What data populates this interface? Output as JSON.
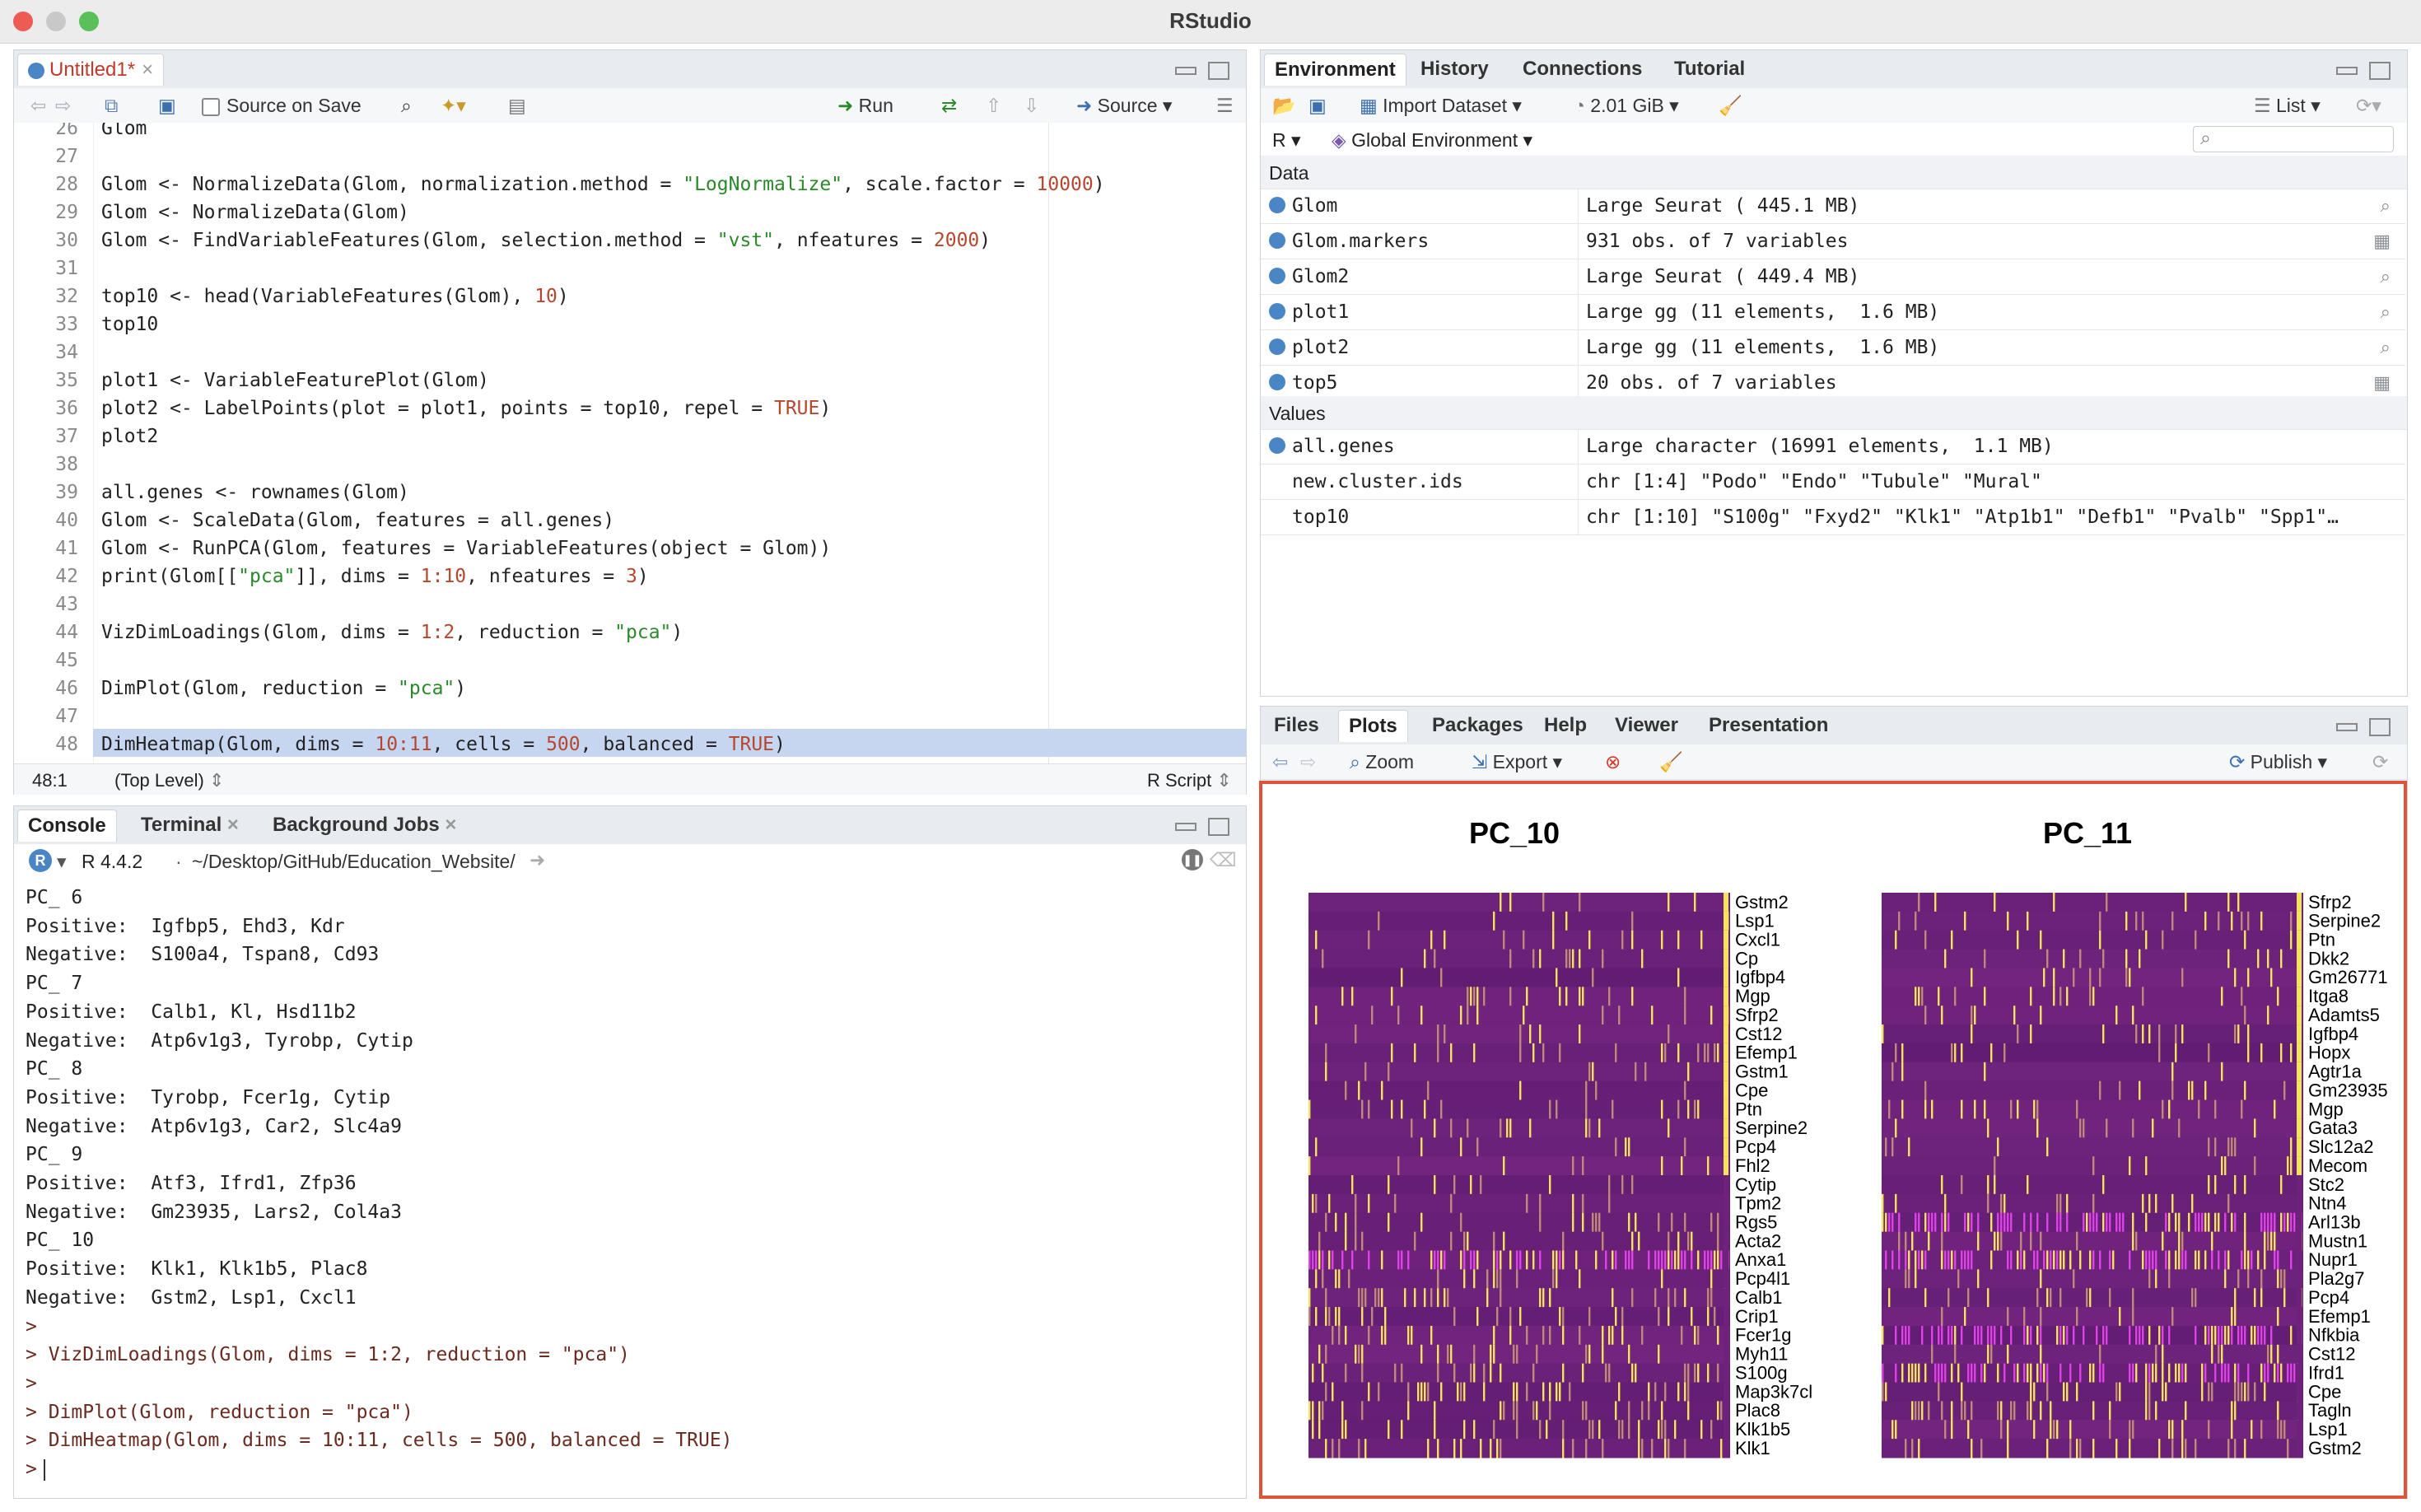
{
  "window": {
    "title": "RStudio"
  },
  "editor": {
    "tab_label": "Untitled1*",
    "source_on_save": "Source on Save",
    "run_label": "Run",
    "source_label": "Source",
    "status_pos": "48:1",
    "status_scope": "(Top Level)",
    "status_type": "R Script",
    "lines": [
      {
        "n": "26",
        "t": "Glom"
      },
      {
        "n": "27",
        "t": ""
      },
      {
        "n": "28",
        "t": "Glom <- NormalizeData(Glom, normalization.method = \"LogNormalize\", scale.factor = 10000)"
      },
      {
        "n": "29",
        "t": "Glom <- NormalizeData(Glom)"
      },
      {
        "n": "30",
        "t": "Glom <- FindVariableFeatures(Glom, selection.method = \"vst\", nfeatures = 2000)"
      },
      {
        "n": "31",
        "t": ""
      },
      {
        "n": "32",
        "t": "top10 <- head(VariableFeatures(Glom), 10)"
      },
      {
        "n": "33",
        "t": "top10"
      },
      {
        "n": "34",
        "t": ""
      },
      {
        "n": "35",
        "t": "plot1 <- VariableFeaturePlot(Glom)"
      },
      {
        "n": "36",
        "t": "plot2 <- LabelPoints(plot = plot1, points = top10, repel = TRUE)"
      },
      {
        "n": "37",
        "t": "plot2"
      },
      {
        "n": "38",
        "t": ""
      },
      {
        "n": "39",
        "t": "all.genes <- rownames(Glom)"
      },
      {
        "n": "40",
        "t": "Glom <- ScaleData(Glom, features = all.genes)"
      },
      {
        "n": "41",
        "t": "Glom <- RunPCA(Glom, features = VariableFeatures(object = Glom))"
      },
      {
        "n": "42",
        "t": "print(Glom[[\"pca\"]], dims = 1:10, nfeatures = 3)"
      },
      {
        "n": "43",
        "t": ""
      },
      {
        "n": "44",
        "t": "VizDimLoadings(Glom, dims = 1:2, reduction = \"pca\")"
      },
      {
        "n": "45",
        "t": ""
      },
      {
        "n": "46",
        "t": "DimPlot(Glom, reduction = \"pca\")"
      },
      {
        "n": "47",
        "t": ""
      },
      {
        "n": "48",
        "t": "DimHeatmap(Glom, dims = 10:11, cells = 500, balanced = TRUE)"
      }
    ]
  },
  "console": {
    "tabs": [
      "Console",
      "Terminal",
      "Background Jobs"
    ],
    "r_version": "R 4.4.2",
    "path": "~/Desktop/GitHub/Education_Website/",
    "lines": [
      "PC_ 6",
      "Positive:  Igfbp5, Ehd3, Kdr",
      "Negative:  S100a4, Tspan8, Cd93",
      "PC_ 7",
      "Positive:  Calb1, Kl, Hsd11b2",
      "Negative:  Atp6v1g3, Tyrobp, Cytip",
      "PC_ 8",
      "Positive:  Tyrobp, Fcer1g, Cytip",
      "Negative:  Atp6v1g3, Car2, Slc4a9",
      "PC_ 9",
      "Positive:  Atf3, Ifrd1, Zfp36",
      "Negative:  Gm23935, Lars2, Col4a3",
      "PC_ 10",
      "Positive:  Klk1, Klk1b5, Plac8",
      "Negative:  Gstm2, Lsp1, Cxcl1",
      ">",
      "> VizDimLoadings(Glom, dims = 1:2, reduction = \"pca\")",
      ">",
      "> DimPlot(Glom, reduction = \"pca\")",
      "> DimHeatmap(Glom, dims = 10:11, cells = 500, balanced = TRUE)",
      ">"
    ]
  },
  "environment": {
    "tabs": [
      "Environment",
      "History",
      "Connections",
      "Tutorial"
    ],
    "import_dataset": "Import Dataset",
    "memory": "2.01 GiB",
    "list_label": "List",
    "lang": "R",
    "scope": "Global Environment",
    "data_header": "Data",
    "values_header": "Values",
    "data": [
      {
        "name": "Glom",
        "value": "Large Seurat ( 445.1 MB)"
      },
      {
        "name": "Glom.markers",
        "value": "931 obs. of 7 variables"
      },
      {
        "name": "Glom2",
        "value": "Large Seurat ( 449.4 MB)"
      },
      {
        "name": "plot1",
        "value": "Large gg (11 elements,  1.6 MB)"
      },
      {
        "name": "plot2",
        "value": "Large gg (11 elements,  1.6 MB)"
      },
      {
        "name": "top5",
        "value": "20 obs. of 7 variables"
      }
    ],
    "values": [
      {
        "name": "all.genes",
        "value": "Large character (16991 elements,  1.1 MB)"
      },
      {
        "name": "new.cluster.ids",
        "value": "chr [1:4] \"Podo\" \"Endo\" \"Tubule\" \"Mural\""
      },
      {
        "name": "top10",
        "value": "chr [1:10] \"S100g\" \"Fxyd2\" \"Klk1\" \"Atp1b1\" \"Defb1\" \"Pvalb\" \"Spp1\"…"
      }
    ]
  },
  "plots": {
    "tabs": [
      "Files",
      "Plots",
      "Packages",
      "Help",
      "Viewer",
      "Presentation"
    ],
    "zoom": "Zoom",
    "export": "Export",
    "publish": "Publish"
  },
  "chart_data": {
    "type": "heatmap",
    "panels": [
      {
        "title": "PC_10",
        "genes": [
          "Gstm2",
          "Lsp1",
          "Cxcl1",
          "Cp",
          "Igfbp4",
          "Mgp",
          "Sfrp2",
          "Cst12",
          "Efemp1",
          "Gstm1",
          "Cpe",
          "Ptn",
          "Serpine2",
          "Pcp4",
          "Fhl2",
          "Cytip",
          "Tpm2",
          "Rgs5",
          "Acta2",
          "Anxa1",
          "Pcp4l1",
          "Calb1",
          "Crip1",
          "Fcer1g",
          "Myh11",
          "S100g",
          "Map3k7cl",
          "Plac8",
          "Klk1b5",
          "Klk1"
        ]
      },
      {
        "title": "PC_11",
        "genes": [
          "Sfrp2",
          "Serpine2",
          "Ptn",
          "Dkk2",
          "Gm26771",
          "Itga8",
          "Adamts5",
          "Igfbp4",
          "Hopx",
          "Agtr1a",
          "Gm23935",
          "Mgp",
          "Gata3",
          "Slc12a2",
          "Mecom",
          "Stc2",
          "Ntn4",
          "Arl13b",
          "Mustn1",
          "Nupr1",
          "Pla2g7",
          "Pcp4",
          "Efemp1",
          "Nfkbia",
          "Cst12",
          "Ifrd1",
          "Cpe",
          "Tagln",
          "Lsp1",
          "Gstm2"
        ]
      }
    ],
    "colors": {
      "low": "#5b1a6e",
      "mid": "#8a2f8f",
      "high": "#f5e35a",
      "hot": "#e040e8"
    }
  }
}
